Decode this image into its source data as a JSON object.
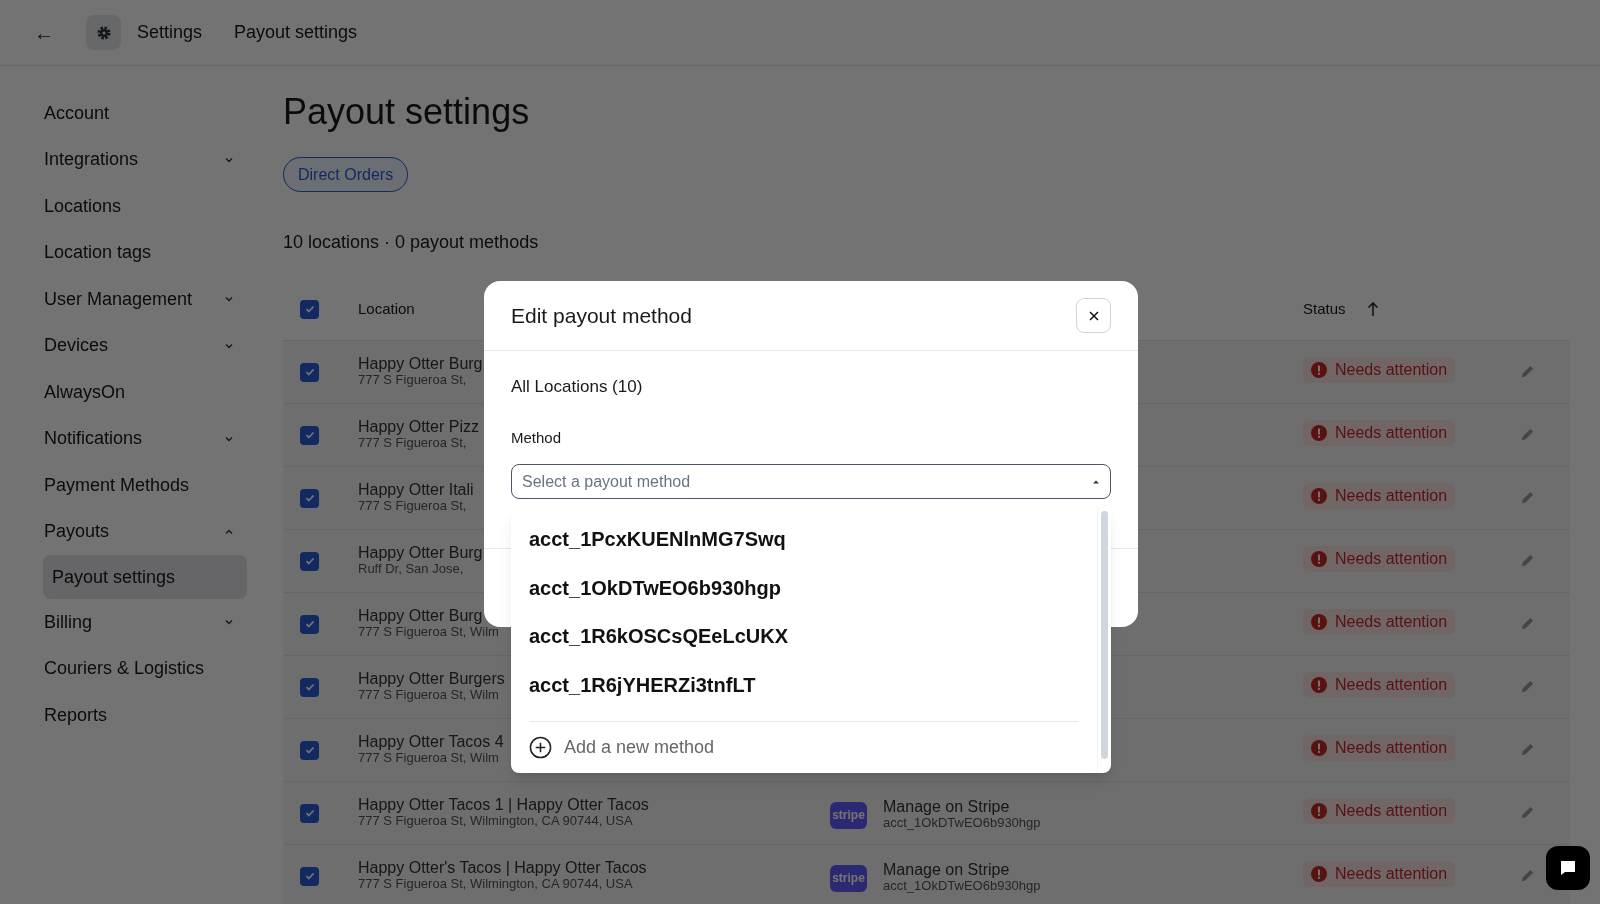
{
  "topbar": {
    "back": "←",
    "section": "Settings",
    "page": "Payout settings"
  },
  "sidebar": {
    "items": [
      {
        "label": "Account",
        "selected": false
      },
      {
        "label": "Integrations",
        "selected": false,
        "expanded": false
      },
      {
        "label": "Locations",
        "selected": false
      },
      {
        "label": "Location tags",
        "selected": false
      },
      {
        "label": "User Management",
        "selected": false,
        "expanded": false
      },
      {
        "label": "Devices",
        "selected": false,
        "expanded": false
      },
      {
        "label": "AlwaysOn",
        "selected": false
      },
      {
        "label": "Notifications",
        "selected": false,
        "expanded": false
      },
      {
        "label": "Payment Methods",
        "selected": false
      },
      {
        "label": "Payouts",
        "selected": false,
        "expanded": true,
        "children": [
          {
            "label": "Payout settings",
            "selected": true
          }
        ]
      },
      {
        "label": "Billing",
        "selected": false,
        "expanded": false
      },
      {
        "label": "Couriers & Logistics",
        "selected": false
      },
      {
        "label": "Reports",
        "selected": false
      }
    ]
  },
  "title": "Payout settings",
  "filter_chip": "Direct Orders",
  "summary": "10 locations · 0 payout methods",
  "table": {
    "select_all_checked": true,
    "columns": {
      "location": "Location",
      "status": "Status"
    },
    "rows": [
      {
        "checked": true,
        "name": "Happy Otter Burg",
        "address": "777 S Figueroa St,",
        "status": "Needs attention"
      },
      {
        "checked": true,
        "name": "Happy Otter Pizz",
        "address": "777 S Figueroa St,",
        "status": "Needs attention"
      },
      {
        "checked": true,
        "name": "Happy Otter Itali",
        "address": "777 S Figueroa St,",
        "status": "Needs attention"
      },
      {
        "checked": true,
        "name": "Happy Otter Burg",
        "address": "Ruff Dr, San Jose,",
        "status": "Needs attention"
      },
      {
        "checked": true,
        "name": "Happy Otter Burg",
        "address": "777 S Figueroa St, Wilm",
        "status": "Needs attention"
      },
      {
        "checked": true,
        "name": "Happy Otter Burgers",
        "address": "777 S Figueroa St, Wilm",
        "status": "Needs attention"
      },
      {
        "checked": true,
        "name": "Happy Otter Tacos 4",
        "address": "777 S Figueroa St, Wilm",
        "status": "Needs attention"
      },
      {
        "checked": true,
        "name": "Happy Otter Tacos 1 | Happy Otter Tacos",
        "address": "777 S Figueroa St, Wilmington, CA 90744, USA",
        "method_logo": "stripe",
        "method": "Manage on Stripe",
        "account": "acct_1OkDTwEO6b930hgp",
        "status": "Needs attention"
      },
      {
        "checked": true,
        "name": "Happy Otter's Tacos | Happy Otter Tacos",
        "address": "777 S Figueroa St, Wilmington, CA 90744, USA",
        "method_logo": "stripe",
        "method": "Manage on Stripe",
        "account": "acct_1OkDTwEO6b930hgp",
        "status": "Needs attention"
      }
    ]
  },
  "modal": {
    "title": "Edit payout method",
    "scope": "All Locations (10)",
    "field_label": "Method",
    "select": {
      "placeholder": "Select a payout method",
      "expanded": true,
      "options": [
        "acct_1PcxKUENlnMG7Swq",
        "acct_1OkDTwEO6b930hgp",
        "acct_1R6kOSCsQEeLcUKX",
        "acct_1R6jYHERZi3tnfLT"
      ],
      "add_option": "Add a new method"
    }
  }
}
